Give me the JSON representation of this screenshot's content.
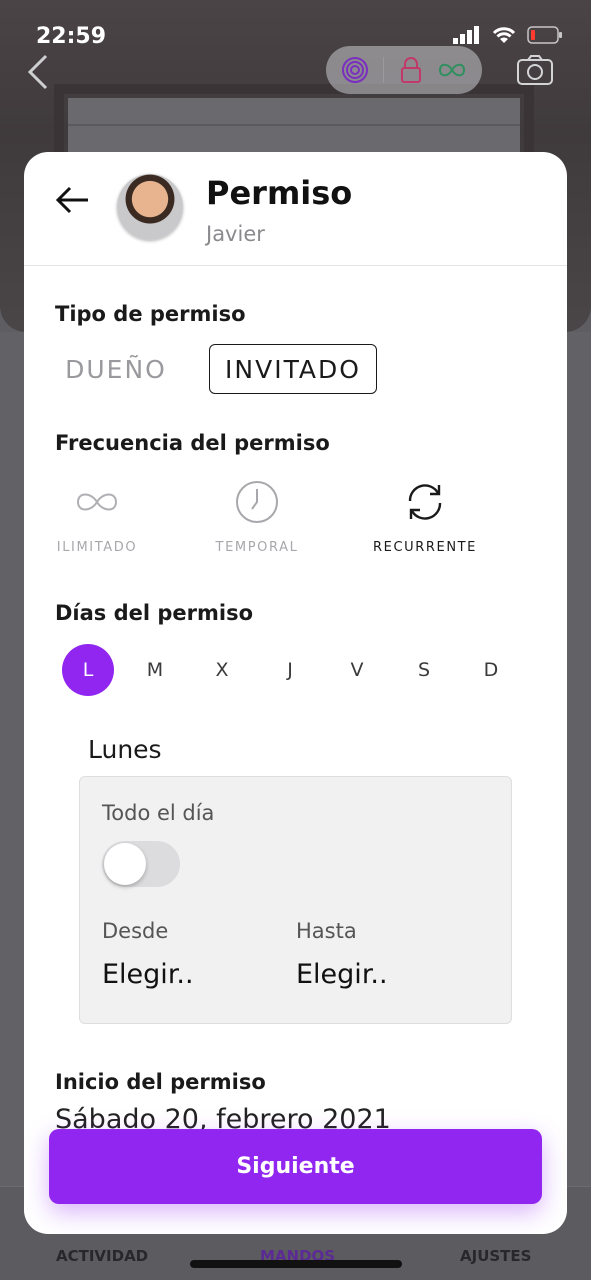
{
  "status_bar": {
    "time": "22:59"
  },
  "header": {
    "title": "Permiso",
    "subtitle": "Javier"
  },
  "permission_type": {
    "label": "Tipo de permiso",
    "options": [
      "DUEÑO",
      "INVITADO"
    ],
    "selected": "INVITADO"
  },
  "frequency": {
    "label": "Frecuencia del permiso",
    "options": [
      {
        "label": "ILIMITADO",
        "icon": "infinity-icon"
      },
      {
        "label": "TEMPORAL",
        "icon": "clock-icon"
      },
      {
        "label": "RECURRENTE",
        "icon": "refresh-icon"
      }
    ],
    "selected": "RECURRENTE"
  },
  "days": {
    "label": "Días del permiso",
    "items": [
      "L",
      "M",
      "X",
      "J",
      "V",
      "S",
      "D"
    ],
    "selected": "L"
  },
  "day_detail": {
    "name": "Lunes",
    "all_day_label": "Todo el día",
    "all_day_on": false,
    "from_label": "Desde",
    "from_value": "Elegir..",
    "to_label": "Hasta",
    "to_value": "Elegir.."
  },
  "start": {
    "label": "Inicio del permiso",
    "value": "Sábado 20, febrero 2021"
  },
  "next_button": "Siguiente",
  "tabs": [
    "ACTIVIDAD",
    "MANDOS",
    "AJUSTES"
  ],
  "active_tab": "MANDOS",
  "colors": {
    "accent": "#9126f0",
    "lock": "#c0396a",
    "infinity": "#2f8f5f",
    "target": "#7a2fbf"
  }
}
